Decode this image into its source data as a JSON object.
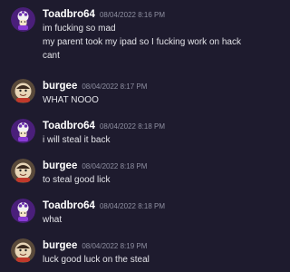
{
  "colors": {
    "background": "#1e1b2e",
    "username": "#ffffff",
    "timestamp": "#8e8fa0",
    "text": "#e3e3e8"
  },
  "messages": [
    {
      "author": "Toadbro64",
      "avatar": "toadbro-avatar",
      "timestamp": "08/04/2022 8:16 PM",
      "lines": [
        "im fucking so mad",
        "my parent took my ipad so I fucking work on hack",
        "cant"
      ]
    },
    {
      "author": "burgee",
      "avatar": "burgee-avatar",
      "timestamp": "08/04/2022 8:17 PM",
      "lines": [
        "WHAT NOOO"
      ]
    },
    {
      "author": "Toadbro64",
      "avatar": "toadbro-avatar",
      "timestamp": "08/04/2022 8:18 PM",
      "lines": [
        "i will steal it back"
      ]
    },
    {
      "author": "burgee",
      "avatar": "burgee-avatar",
      "timestamp": "08/04/2022 8:18 PM",
      "lines": [
        "to steal good lick"
      ]
    },
    {
      "author": "Toadbro64",
      "avatar": "toadbro-avatar",
      "timestamp": "08/04/2022 8:18 PM",
      "lines": [
        "what"
      ]
    },
    {
      "author": "burgee",
      "avatar": "burgee-avatar",
      "timestamp": "08/04/2022 8:19 PM",
      "lines": [
        "luck good luck on the steal"
      ]
    }
  ]
}
